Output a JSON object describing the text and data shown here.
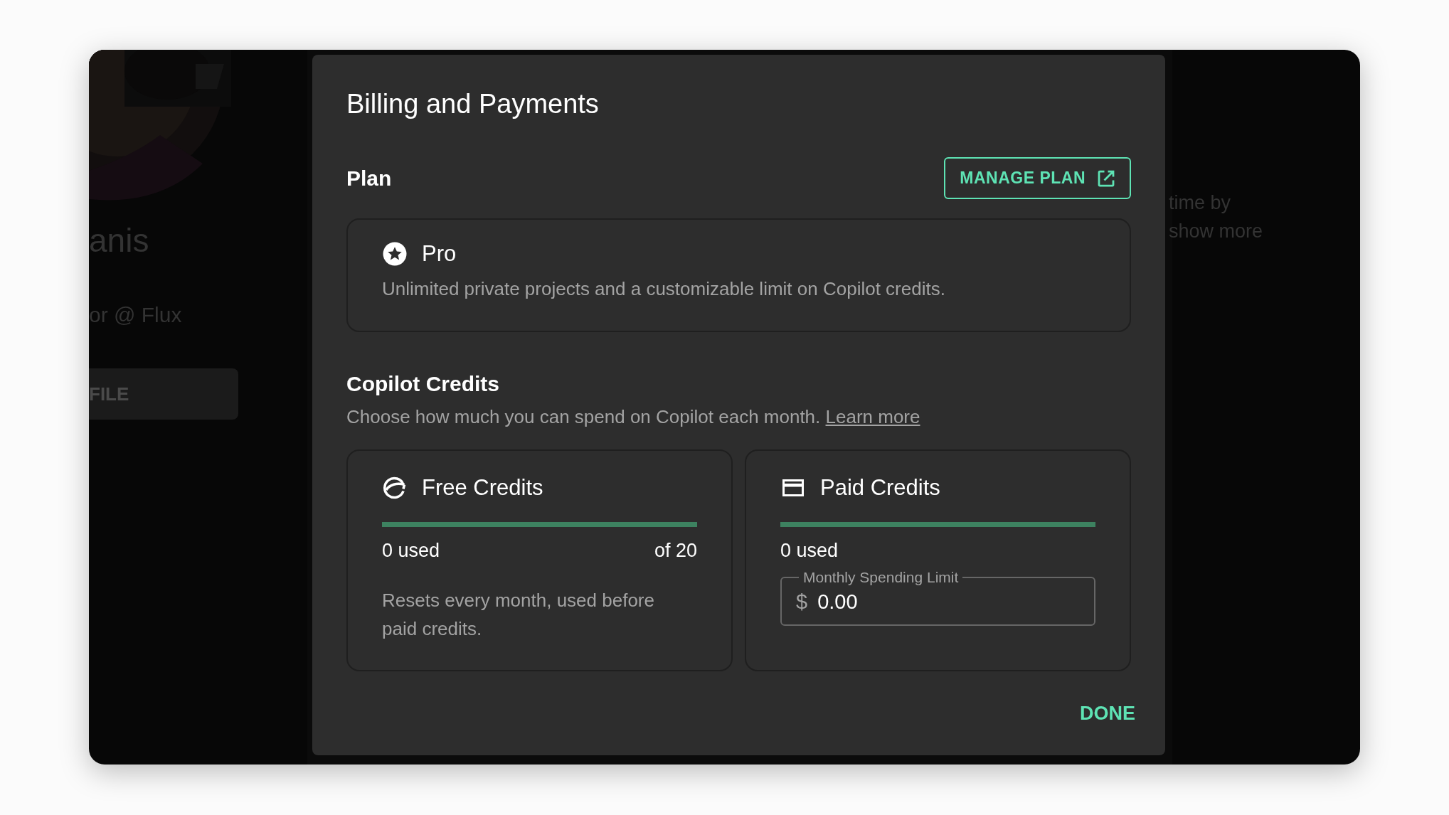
{
  "background": {
    "profile_name": "anis",
    "profile_role": "or @ Flux",
    "profile_button": "FILE",
    "side_text_lines": [
      "time by",
      "show more"
    ]
  },
  "dialog": {
    "title": "Billing and Payments",
    "plan": {
      "heading": "Plan",
      "manage_button": "MANAGE PLAN",
      "name": "Pro",
      "description": "Unlimited private projects and a customizable limit on Copilot credits."
    },
    "credits": {
      "heading": "Copilot Credits",
      "description": "Choose how much you can spend on Copilot each month.",
      "link": "Learn more",
      "cards": [
        {
          "kind": "free",
          "title": "Free Credits",
          "level": 1,
          "used": "0 used",
          "total": "of 20",
          "note": "Resets every month, used before paid credits."
        },
        {
          "kind": "paid",
          "title": "Paid Credits",
          "level": 1,
          "used": "0 used",
          "field": {
            "label": "Monthly Spending Limit",
            "prefix": "$",
            "value": "0.00"
          }
        }
      ]
    },
    "done_button": "DONE"
  }
}
